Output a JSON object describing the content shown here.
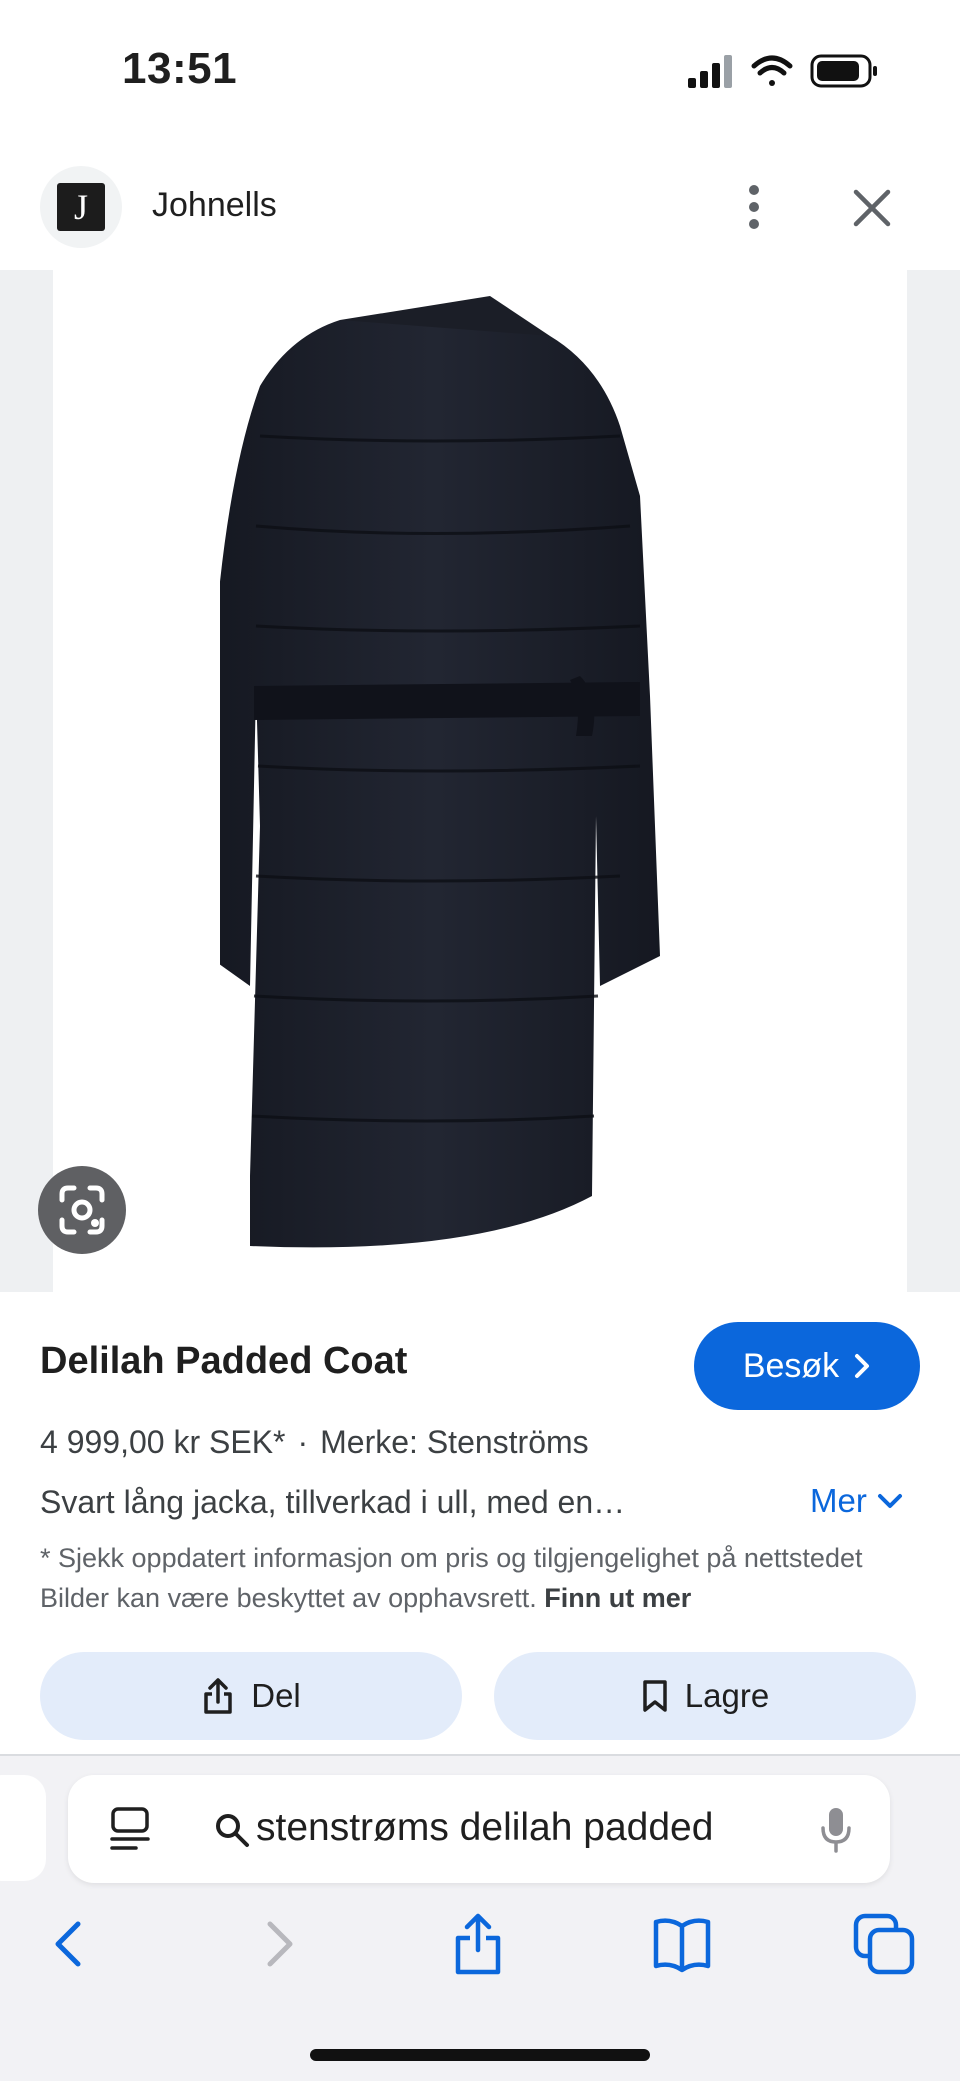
{
  "status_bar": {
    "time": "13:51"
  },
  "header": {
    "logo_letter": "J",
    "site_name": "Johnells"
  },
  "product": {
    "title": "Delilah Padded Coat",
    "visit_label": "Besøk",
    "price": "4 999,00 kr SEK*",
    "separator": "·",
    "brand": "Merke: Stenströms",
    "description": "Svart lång jacka, tillverkad i ull, med en…",
    "more_label": "Mer",
    "disclaimer": "* Sjekk oppdatert informasjon om pris og tilgjengelighet på nettstedet Bilder kan være beskyttet av opphavsrett.",
    "learn_more": "Finn ut mer"
  },
  "actions": {
    "share_label": "Del",
    "save_label": "Lagre"
  },
  "browser": {
    "address_text": "stenstrøms delilah padded"
  },
  "colors": {
    "accent": "#0b67dc",
    "pill_bg": "#e3ecfa",
    "toolbar_icon": "#0b67dc"
  },
  "icons": {
    "more": "more-vert-icon",
    "close": "close-icon",
    "lens": "lens-icon",
    "visit": "chevron-right-icon",
    "more_expand": "chevron-down-icon",
    "share": "share-icon",
    "save": "bookmark-icon",
    "reader": "reader-icon",
    "search": "search-icon",
    "mic": "mic-icon",
    "back": "back-icon",
    "forward": "forward-icon",
    "bookmarks": "bookmarks-icon",
    "tabs": "tabs-icon"
  }
}
